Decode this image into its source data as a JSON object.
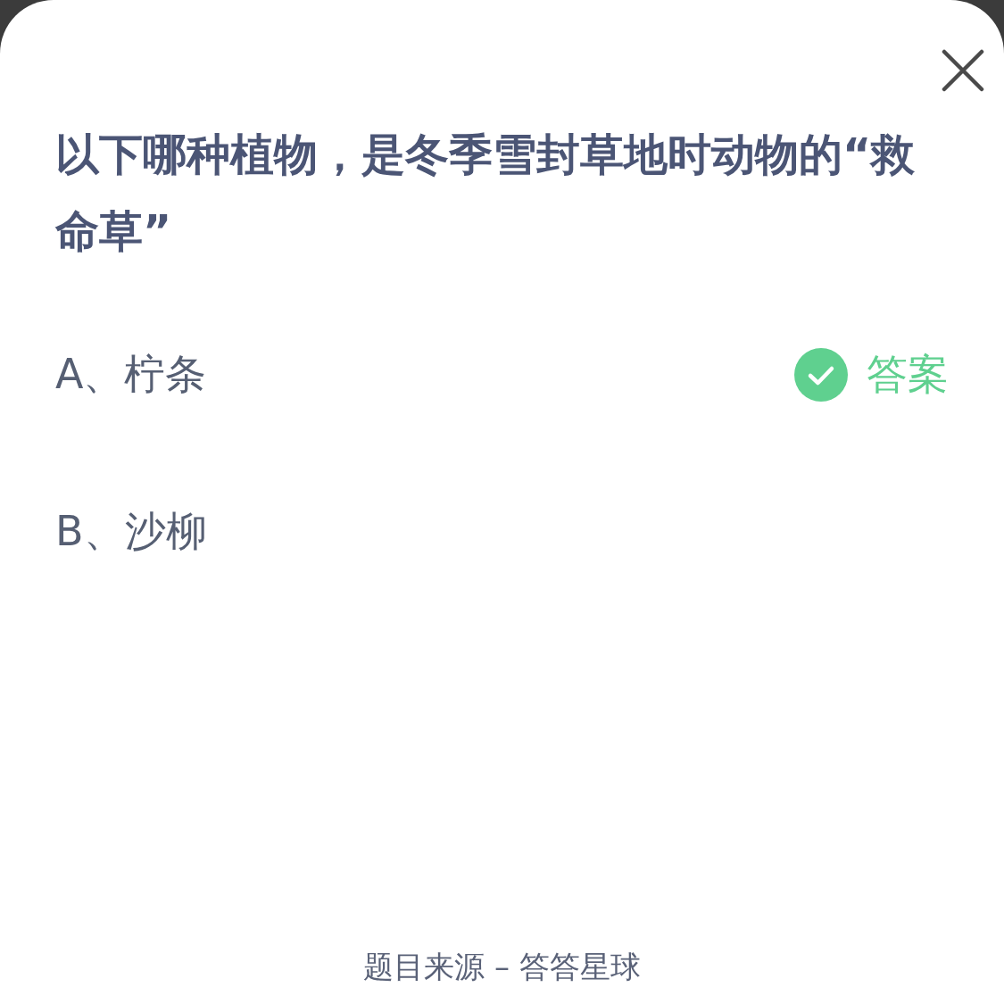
{
  "question": "以下哪种植物，是冬季雪封草地时动物的“救命草”",
  "options": [
    {
      "label": "A、柠条",
      "correct": true,
      "tag": "答案"
    },
    {
      "label": "B、沙柳",
      "correct": false
    }
  ],
  "footer": "题目来源 – 答答星球"
}
